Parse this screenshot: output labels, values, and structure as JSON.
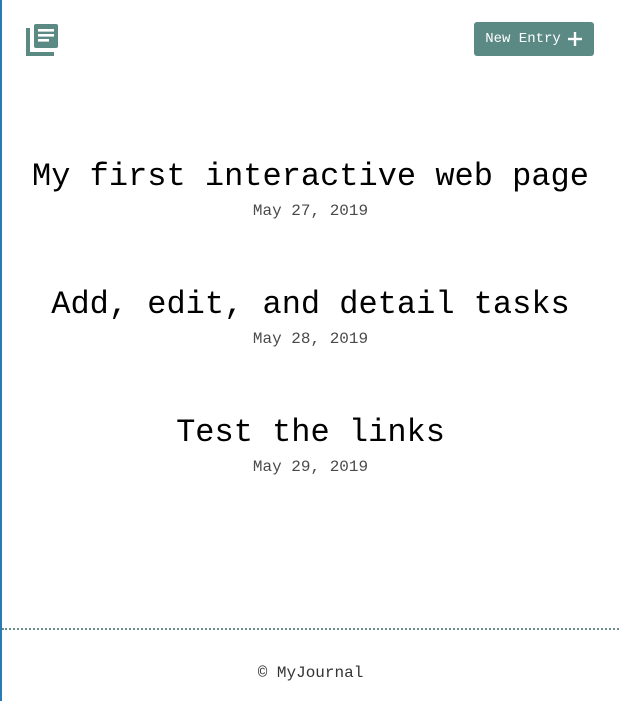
{
  "header": {
    "logo_icon": "journal-stack-icon",
    "new_entry_label": "New Entry",
    "new_entry_icon": "plus-icon"
  },
  "entries": [
    {
      "title": "My first interactive web page",
      "date": "May 27, 2019"
    },
    {
      "title": "Add, edit, and detail tasks",
      "date": "May 28, 2019"
    },
    {
      "title": "Test the links",
      "date": "May 29, 2019"
    }
  ],
  "footer": {
    "copyright": "© MyJournal"
  },
  "colors": {
    "accent": "#5b8a85",
    "text": "#000000",
    "date_text": "#4a4a4a"
  }
}
